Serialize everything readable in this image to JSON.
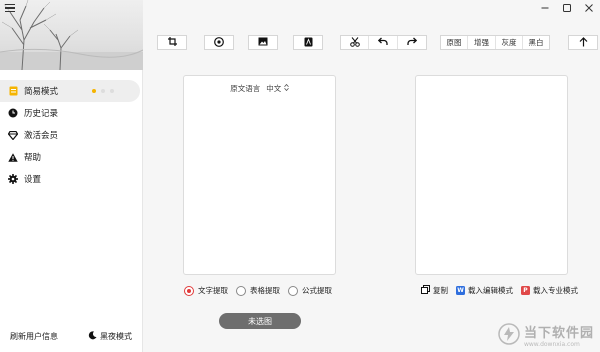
{
  "sidebar": {
    "items": [
      {
        "label": "简易模式",
        "icon": "doc-icon",
        "active": true
      },
      {
        "label": "历史记录",
        "icon": "clock-icon",
        "active": false
      },
      {
        "label": "激活会员",
        "icon": "diamond-icon",
        "active": false
      },
      {
        "label": "帮助",
        "icon": "warning-icon",
        "active": false
      },
      {
        "label": "设置",
        "icon": "gear-icon",
        "active": false
      }
    ],
    "refresh_label": "刷新用户信息",
    "night_label": "黑夜模式"
  },
  "toolbar": {
    "filters": [
      "原图",
      "增强",
      "灰度",
      "黑白"
    ]
  },
  "source": {
    "language_label": "原文语言",
    "language_value": "中文"
  },
  "options": {
    "items": [
      "文字提取",
      "表格提取",
      "公式提取"
    ],
    "selected": 0
  },
  "main": {
    "not_selected_label": "未选图"
  },
  "actions": {
    "copy_label": "复制",
    "edit_mode_label": "载入编辑模式",
    "pro_mode_label": "载入专业模式"
  },
  "watermark": {
    "cn": "当下软件园",
    "en": "www.downxia.com"
  },
  "colors": {
    "accent": "#e03a3a",
    "active_dot": "#f5b400",
    "word_blue": "#2f6fde",
    "pdf_red": "#e04848"
  }
}
